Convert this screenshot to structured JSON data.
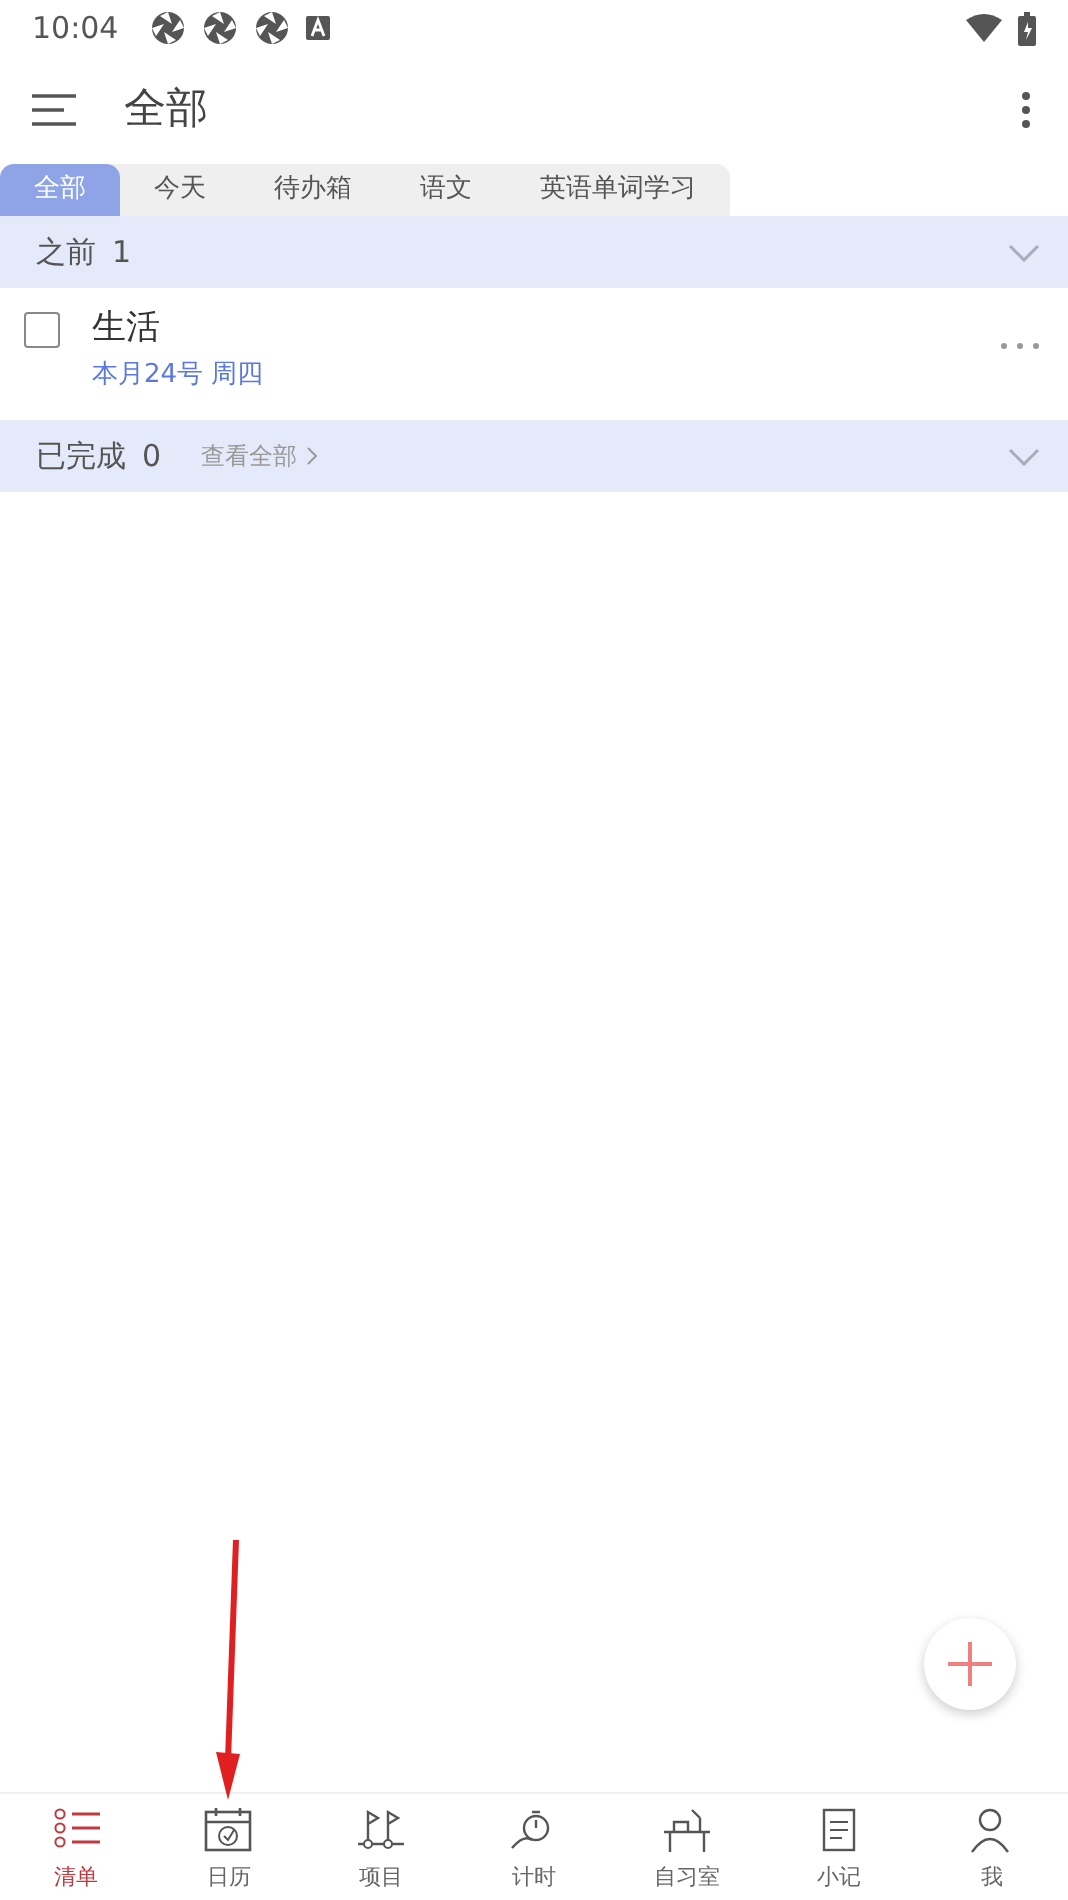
{
  "status_bar": {
    "time": "10:04"
  },
  "toolbar": {
    "title": "全部"
  },
  "tabs": [
    {
      "label": "全部",
      "selected": true
    },
    {
      "label": "今天",
      "selected": false
    },
    {
      "label": "待办箱",
      "selected": false
    },
    {
      "label": "语文",
      "selected": false
    },
    {
      "label": "英语单词学习",
      "selected": false
    }
  ],
  "sections": [
    {
      "title": "之前",
      "count": "1",
      "tasks": [
        {
          "title": "生活",
          "date": "本月24号 周四",
          "checked": false
        }
      ]
    },
    {
      "title": "已完成",
      "count": "0",
      "link": "查看全部"
    }
  ],
  "bottom_nav": [
    {
      "label": "清单",
      "selected": true
    },
    {
      "label": "日历",
      "selected": false
    },
    {
      "label": "项目",
      "selected": false
    },
    {
      "label": "计时",
      "selected": false
    },
    {
      "label": "自习室",
      "selected": false
    },
    {
      "label": "小记",
      "selected": false
    },
    {
      "label": "我",
      "selected": false
    }
  ]
}
